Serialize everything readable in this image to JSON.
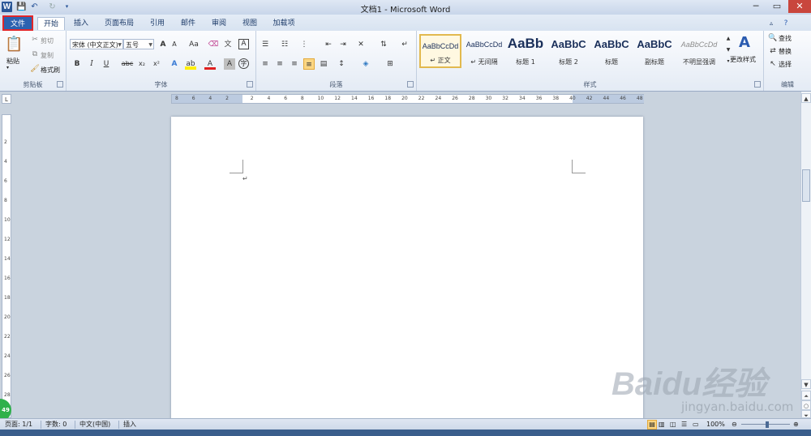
{
  "window": {
    "title": "文档1 - Microsoft Word"
  },
  "tabs": [
    "文件",
    "开始",
    "插入",
    "页面布局",
    "引用",
    "邮件",
    "审阅",
    "视图",
    "加载项"
  ],
  "clipboard": {
    "paste": "粘贴",
    "cut": "剪切",
    "copy": "复制",
    "format_painter": "格式刷",
    "label": "剪贴板"
  },
  "font": {
    "name": "宋体 (中文正文)",
    "size": "五号",
    "grow": "A",
    "shrink": "A",
    "case": "Aa",
    "bold": "B",
    "italic": "I",
    "underline": "U",
    "strike": "abc",
    "subscript": "x₂",
    "superscript": "x²",
    "label": "字体"
  },
  "paragraph": {
    "label": "段落"
  },
  "styles": {
    "label": "样式",
    "items": [
      {
        "sample": "AaBbCcDd",
        "name": "↵ 正文"
      },
      {
        "sample": "AaBbCcDd",
        "name": "↵ 无间隔"
      },
      {
        "sample": "AaBb",
        "name": "标题 1"
      },
      {
        "sample": "AaBbC",
        "name": "标题 2"
      },
      {
        "sample": "AaBbC",
        "name": "标题"
      },
      {
        "sample": "AaBbC",
        "name": "副标题"
      },
      {
        "sample": "AaBbCcDd",
        "name": "不明显强调"
      }
    ],
    "change": "更改样式"
  },
  "editing": {
    "find": "查找",
    "replace": "替换",
    "select": "选择",
    "label": "编辑"
  },
  "ruler": {
    "h": [
      "8",
      "6",
      "4",
      "2",
      "2",
      "4",
      "6",
      "8",
      "10",
      "12",
      "14",
      "16",
      "18",
      "20",
      "22",
      "24",
      "26",
      "28",
      "30",
      "32",
      "34",
      "36",
      "38",
      "40",
      "42",
      "44",
      "46",
      "48"
    ],
    "v": [
      "2",
      "4",
      "6",
      "8",
      "10",
      "12",
      "14",
      "16",
      "18",
      "20",
      "22",
      "24",
      "26",
      "28"
    ]
  },
  "status": {
    "page": "页面: 1/1",
    "words": "字数: 0",
    "language": "中文(中国)",
    "mode": "插入",
    "zoom": "100%"
  },
  "badge": "49",
  "watermark": {
    "brand": "Baidu经验",
    "url": "jingyan.baidu.com"
  }
}
